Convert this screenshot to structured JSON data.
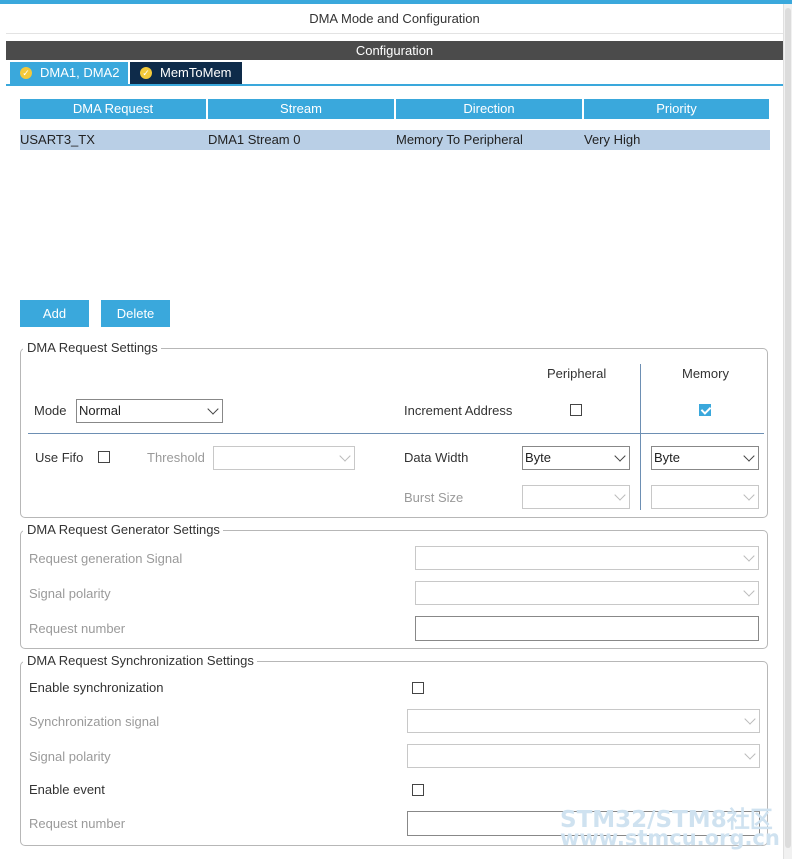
{
  "window": {
    "title": "DMA Mode and Configuration"
  },
  "config_bar": {
    "label": "Configuration"
  },
  "tabs": [
    {
      "label": "DMA1, DMA2",
      "active": true
    },
    {
      "label": "MemToMem",
      "active": false
    }
  ],
  "table": {
    "headers": [
      "DMA Request",
      "Stream",
      "Direction",
      "Priority"
    ],
    "rows": [
      [
        "USART3_TX",
        "DMA1 Stream 0",
        "Memory To Peripheral",
        "Very High"
      ]
    ]
  },
  "buttons": {
    "add": "Add",
    "delete": "Delete"
  },
  "request_settings": {
    "legend": "DMA Request Settings",
    "peripheral_col": "Peripheral",
    "memory_col": "Memory",
    "mode_label": "Mode",
    "mode_value": "Normal",
    "increment_label": "Increment Address",
    "peripheral_increment": false,
    "memory_increment": true,
    "fifo_label": "Use Fifo",
    "fifo_checked": false,
    "threshold_label": "Threshold",
    "threshold_value": "",
    "data_width_label": "Data Width",
    "peripheral_width": "Byte",
    "memory_width": "Byte",
    "burst_label": "Burst Size",
    "peripheral_burst": "",
    "memory_burst": ""
  },
  "generator_settings": {
    "legend": "DMA Request Generator Settings",
    "signal_label": "Request generation Signal",
    "polarity_label": "Signal polarity",
    "number_label": "Request number"
  },
  "sync_settings": {
    "legend": "DMA Request Synchronization Settings",
    "enable_sync_label": "Enable synchronization",
    "sync_signal_label": "Synchronization signal",
    "polarity_label": "Signal polarity",
    "enable_event_label": "Enable event",
    "number_label": "Request number"
  },
  "watermark": {
    "line1": "STM32/STM8社区",
    "line2": "www.stmcu.org.cn"
  },
  "colors": {
    "accent": "#3aa8dc",
    "dark_tab": "#0e2b4a",
    "selected_row": "#b9cfe6",
    "header_bar": "#4b4b4b"
  }
}
